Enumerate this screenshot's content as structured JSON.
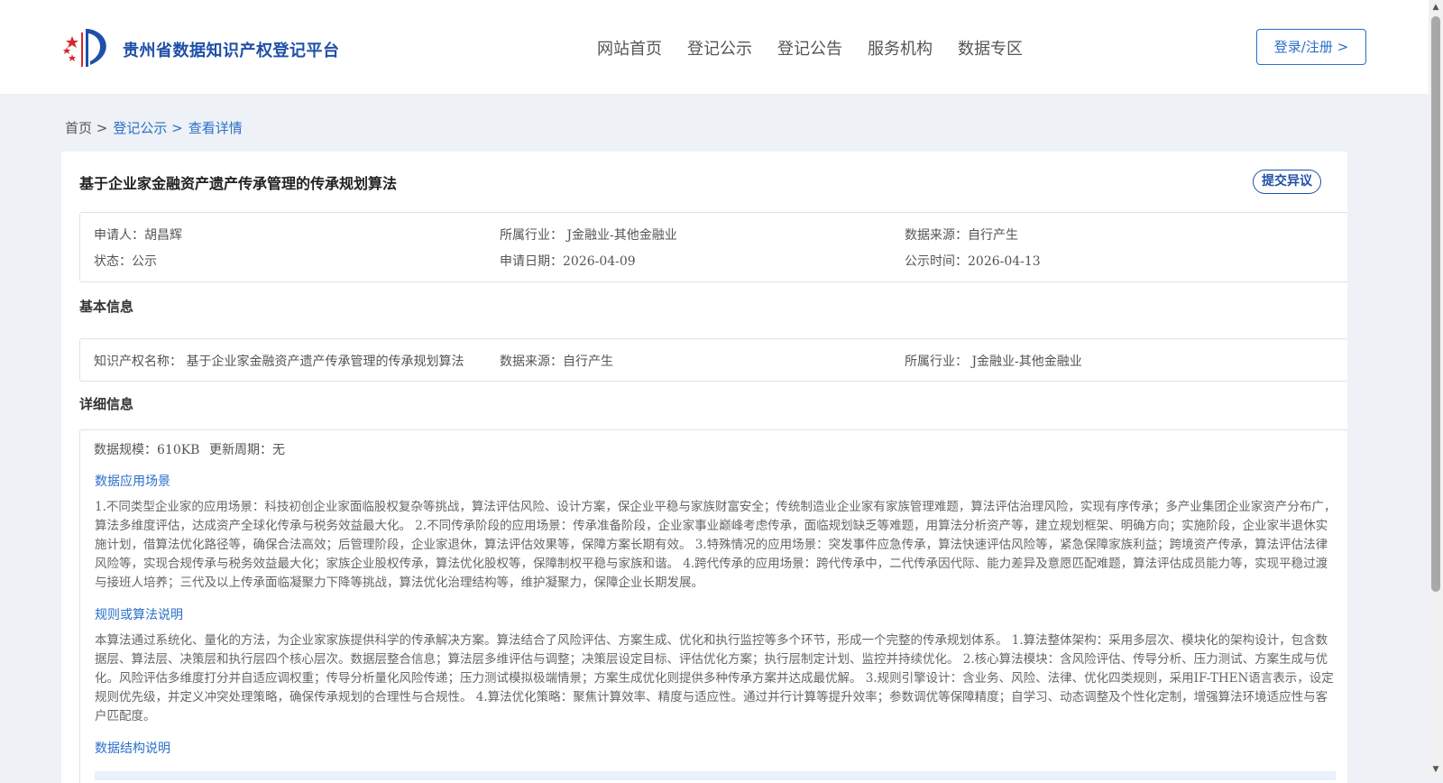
{
  "header": {
    "brand": "贵州省数据知识产权登记平台",
    "nav": [
      "网站首页",
      "登记公示",
      "登记公告",
      "服务机构",
      "数据专区"
    ],
    "login_label": "登录/注册 >",
    "colors": {
      "brand": "#1f4fa8",
      "accent": "#2a6fc9",
      "logo_red": "#d9272e"
    }
  },
  "breadcrumb": {
    "home": "首页 >",
    "list": "登记公示 >",
    "current": "查看详情"
  },
  "detail": {
    "title": "基于企业家金融资产遗产传承管理的传承规划算法",
    "objection_label": "提交异议",
    "summary": {
      "applicant": "申请人：胡昌辉",
      "industry": "所属行业： J金融业-其他金融业",
      "source": "数据来源：自行产生",
      "status": "状态：公示",
      "apply_date": "申请日期：2026-04-09",
      "publish_date": "公示时间：2026-04-13"
    },
    "basic": {
      "heading": "基本信息",
      "ip_name": "知识产权名称： 基于企业家金融资产遗产传承管理的传承规划算法",
      "source": "数据来源：自行产生",
      "industry": "所属行业： J金融业-其他金融业"
    },
    "details": {
      "heading": "详细信息",
      "scale": "数据规模：610KB",
      "cycle": "更新周期：无",
      "scenario_title": "数据应用场景",
      "scenario_text": "1.不同类型企业家的应用场景：科技初创企业家面临股权复杂等挑战，算法评估风险、设计方案，保企业平稳与家族财富安全；传统制造业企业家有家族管理难题，算法评估治理风险，实现有序传承；多产业集团企业家资产分布广，算法多维度评估，达成资产全球化传承与税务效益最大化。 2.不同传承阶段的应用场景：传承准备阶段，企业家事业巅峰考虑传承，面临规划缺乏等难题，用算法分析资产等，建立规划框架、明确方向；实施阶段，企业家半退休实施计划，借算法优化路径等，确保合法高效；后管理阶段，企业家退休，算法评估效果等，保障方案长期有效。 3.特殊情况的应用场景：突发事件应急传承，算法快速评估风险等，紧急保障家族利益；跨境资产传承，算法评估法律风险等，实现合规传承与税务效益最大化；家族企业股权传承，算法优化股权等，保障制权平稳与家族和谐。 4.跨代传承的应用场景：跨代传承中，二代传承因代际、能力差异及意愿匹配难题，算法评估成员能力等，实现平稳过渡与接班人培养；三代及以上传承面临凝聚力下降等挑战，算法优化治理结构等，维护凝聚力，保障企业长期发展。",
      "algo_title": "规则或算法说明",
      "algo_text": "本算法通过系统化、量化的方法，为企业家家族提供科学的传承解决方案。算法结合了风险评估、方案生成、优化和执行监控等多个环节，形成一个完整的传承规划体系。 1.算法整体架构：采用多层次、模块化的架构设计，包含数据层、算法层、决策层和执行层四个核心层次。数据层整合信息；算法层多维评估与调整；决策层设定目标、评估优化方案；执行层制定计划、监控并持续优化。 2.核心算法模块：含风险评估、传导分析、压力测试、方案生成与优化。风险评估多维度打分并自适应调权重；传导分析量化风险传递；压力测试模拟极端情景；方案生成优化则提供多种传承方案并达成最优解。 3.规则引擎设计：含业务、风险、法律、优化四类规则，采用IF-THEN语言表示，设定规则优先级，并定义冲突处理策略，确保传承规划的合理性与合规性。 4.算法优化策略：聚焦计算效率、精度与适应性。通过并行计算等提升效率；参数调优等保障精度；自学习、动态调整及个性化定制，增强算法环境适应性与客户匹配度。",
      "struct_title": "数据结构说明"
    }
  }
}
